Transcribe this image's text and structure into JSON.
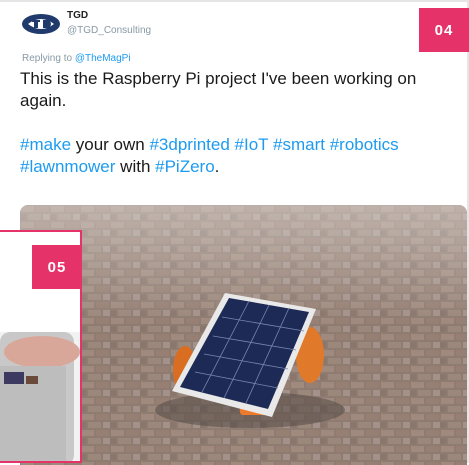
{
  "tweet": {
    "name": "TGD",
    "handle": "@TGD_Consulting",
    "replying_prefix": "Replying to ",
    "replying_to": "@TheMagPi",
    "line1": "This is the Raspberry Pi project I've been working on again.",
    "line2": [
      {
        "text": "#make",
        "tag": true
      },
      {
        "text": " your own ",
        "tag": false
      },
      {
        "text": "#3dprinted",
        "tag": true
      },
      {
        "text": " ",
        "tag": false
      },
      {
        "text": "#IoT",
        "tag": true
      },
      {
        "text": " ",
        "tag": false
      },
      {
        "text": "#smart",
        "tag": true
      },
      {
        "text": " ",
        "tag": false
      },
      {
        "text": "#robotics",
        "tag": true
      },
      {
        "text": " ",
        "tag": false
      },
      {
        "text": "#lawnmower",
        "tag": true
      },
      {
        "text": " with ",
        "tag": false
      },
      {
        "text": "#PiZero",
        "tag": true
      },
      {
        "text": ".",
        "tag": false
      }
    ]
  },
  "badges": {
    "top": "04",
    "inset": "05"
  },
  "colors": {
    "accent": "#e5336a",
    "link": "#1d9bf0"
  }
}
